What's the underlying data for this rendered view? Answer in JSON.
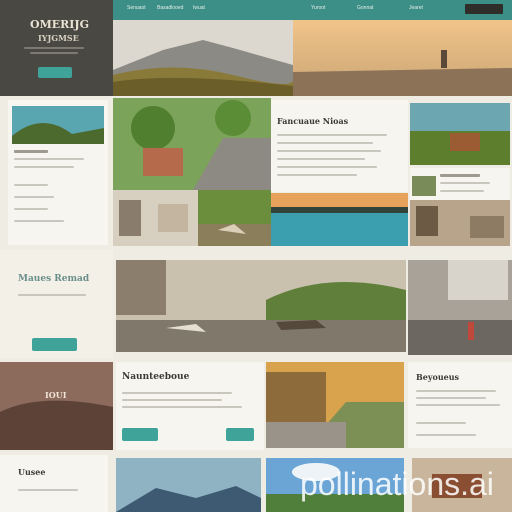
{
  "hero": {
    "title_line1": "OMERIJG",
    "title_line2": "IYJGMSE",
    "cta_label": "",
    "nav": {
      "items": [
        "Senuaot",
        "Basadlooed",
        "Iwuat"
      ],
      "items_right": [
        "Yuroot",
        "Gonnat",
        "Jearet"
      ]
    }
  },
  "featured": {
    "title": "Fancuaue Nioas"
  },
  "section_mid": {
    "title": "Maues Remad",
    "cta_label": ""
  },
  "section_lower": {
    "badge": "IOUI",
    "title": "Naunteeboue",
    "cta_label": "",
    "cta2_label": ""
  },
  "card_right": {
    "title": "Beyoueus"
  },
  "footer_left": {
    "title": "Uusee"
  },
  "watermark": "pollinations.ai",
  "colors": {
    "accent": "#3fa39a",
    "hero_dark": "#4a4843",
    "cream": "#f3f0e7"
  }
}
